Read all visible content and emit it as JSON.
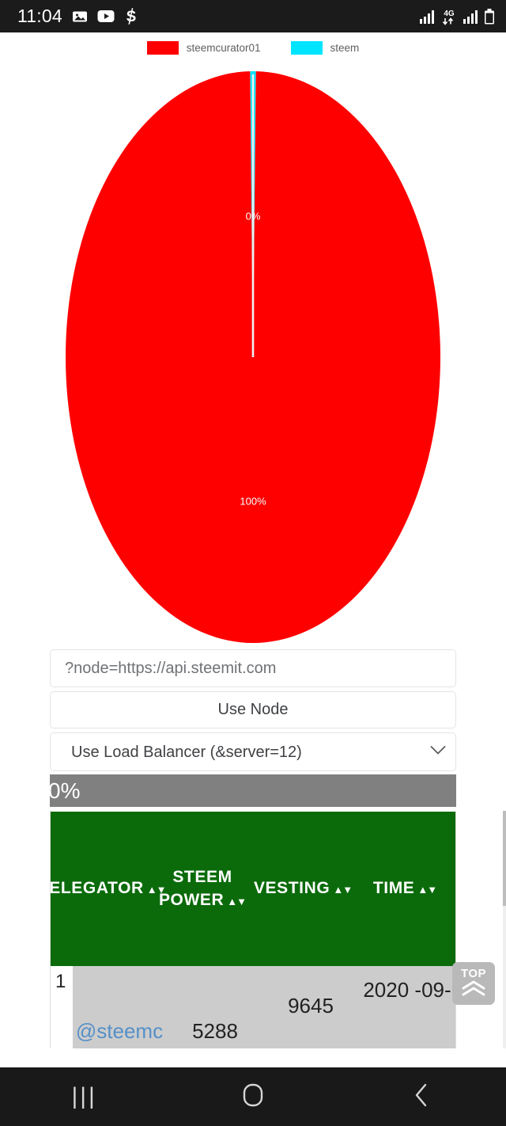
{
  "status_bar": {
    "clock": "11:04",
    "left_icons": [
      "gallery-icon",
      "youtube-icon",
      "steem-icon"
    ],
    "right_icons": [
      "signal-bars-icon",
      "4g-data-icon",
      "signal-bars-2-icon",
      "battery-icon"
    ],
    "network_label": "4G",
    "background": "#1b1b1b"
  },
  "legend": {
    "items": [
      {
        "label": "steemcurator01",
        "color": "#ff0000"
      },
      {
        "label": "steem",
        "color": "#00e5ff"
      }
    ]
  },
  "chart_data": {
    "type": "pie",
    "title": "",
    "categories": [
      "steemcurator01",
      "steem"
    ],
    "values": [
      100,
      0
    ],
    "labels": [
      "100%",
      "0%"
    ],
    "colors": [
      "#ff0000",
      "#00e5ff"
    ],
    "legend_position": "top",
    "slice_label_color": "#ffffff",
    "notes": "Near-full red slice (100%) with a thin cyan sliver (0%) at the 12 o'clock position"
  },
  "form": {
    "node_input": {
      "value": "",
      "placeholder": "?node=https://api.steemit.com"
    },
    "use_node_button": "Use Node",
    "load_balancer_select": {
      "selected": "Use Load Balancer (&server=12)",
      "options": [
        "Use Load Balancer (&server=12)"
      ]
    }
  },
  "progress": {
    "text": "0%",
    "percent": 0,
    "track_color": "#808080"
  },
  "table": {
    "header_color": "#0b6b0b",
    "columns": [
      {
        "label": "DELEGATOR",
        "sort": "▲▼"
      },
      {
        "label": "STEEM POWER",
        "sort": "▲▼"
      },
      {
        "label": "VESTING",
        "sort": "▲▼"
      },
      {
        "label": "TIME",
        "sort": "▲▼"
      }
    ],
    "rows": [
      {
        "index": "1",
        "delegator": "@steemc",
        "steem_power": "5288",
        "vesting": "9645",
        "time": "2020 -09-"
      }
    ]
  },
  "top_button": {
    "label": "TOP",
    "icon": "double-chevron-up-icon"
  },
  "nav_bar": {
    "recents": "|||",
    "home": "home-icon",
    "back": "back-icon"
  }
}
